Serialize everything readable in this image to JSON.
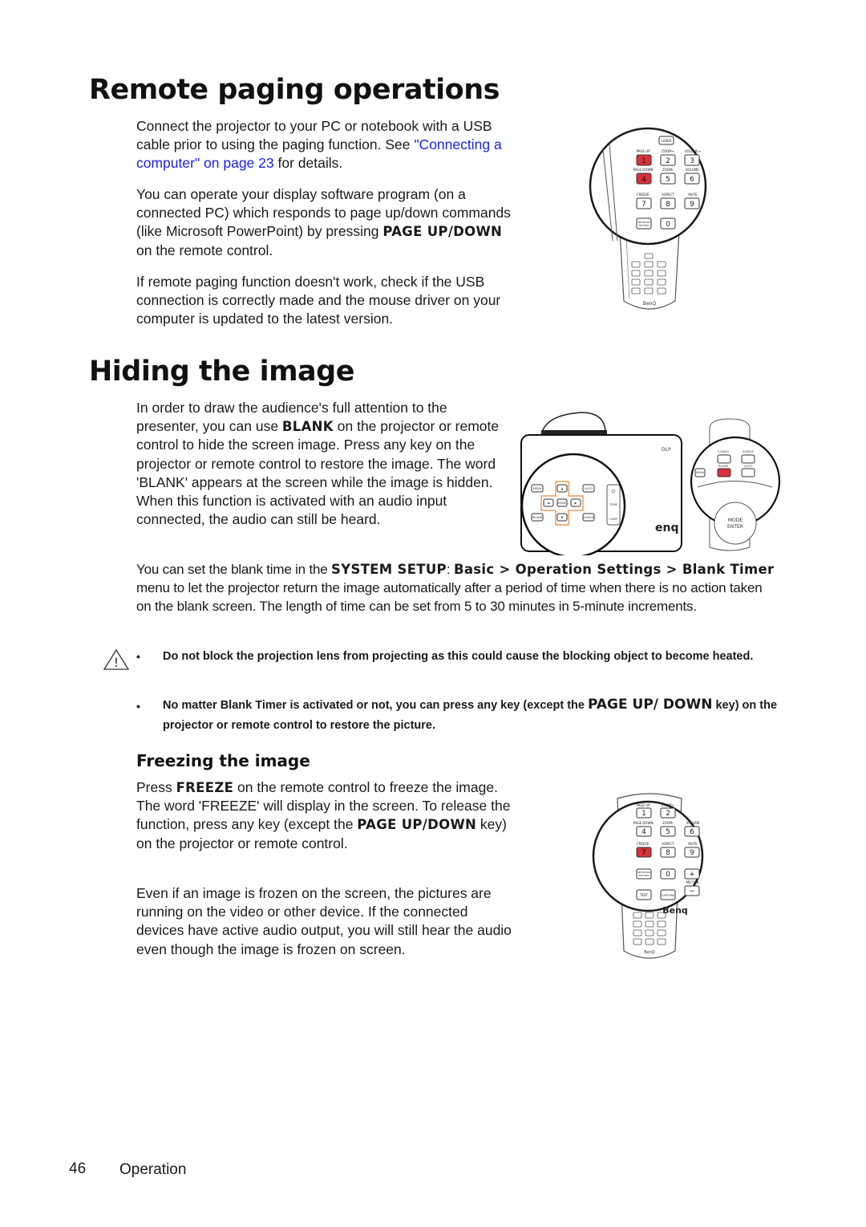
{
  "sections": {
    "remote_paging": {
      "title": "Remote paging operations",
      "p1_text_a": "Connect the projector to your PC or notebook with a USB cable prior to using the paging function. See ",
      "p1_link": "\"Connecting a computer\" on page 23",
      "p1_text_b": " for details.",
      "p2_text_a": "You can operate your display software program (on a connected PC) which responds to page up/down commands (like Microsoft PowerPoint) by pressing ",
      "p2_bold": "PAGE UP/DOWN",
      "p2_text_b": " on the remote control.",
      "p3": "If remote paging function doesn't work, check if the USB connection is correctly made and the mouse driver on your computer is updated to the latest version."
    },
    "hiding": {
      "title": "Hiding the image",
      "p1_text_a": "In order to draw the audience's full attention to the presenter, you can use ",
      "p1_bold": "BLANK",
      "p1_text_b": " on the projector or remote control to hide the screen image. Press any key on the projector or remote control to restore the image. The word 'BLANK' appears at the screen while the image is hidden. When this function is activated with an audio input connected, the audio can still be heard.",
      "p2_text_a": "You can set the blank time in the ",
      "p2_bold_a": "SYSTEM SETUP",
      "p2_colon": ": ",
      "p2_bold_b": "Basic > Operation Settings > Blank Timer",
      "p2_text_b": " menu to let the projector return the image automatically after a period of time when there is no action taken on the blank screen. The length of time can be set from 5 to 30 minutes in 5-minute increments.",
      "notes": [
        {
          "text": "Do not block the projection lens from projecting as this could cause the blocking object to become heated."
        },
        {
          "text_a": "No matter Blank Timer is activated or not, you can press any key (except the ",
          "bold": "PAGE UP/ DOWN",
          "text_b": " key) on the projector or remote control to restore the picture."
        }
      ]
    },
    "freezing": {
      "title": "Freezing the image",
      "p1_text_a": "Press ",
      "p1_bold_a": "FREEZE",
      "p1_text_b": " on the remote control to freeze the image. The word 'FREEZE' will display in the screen. To release the function, press any key (except the ",
      "p1_bold_b": "PAGE UP/DOWN",
      "p1_text_c": " key) on the projector or remote control.",
      "p2": "Even if an image is frozen on the screen, the pictures are running on the video or other device. If the connected devices have active audio output, you will still hear the audio even though the image is frozen on screen."
    }
  },
  "figures": {
    "remote1": {
      "keys": [
        "LASER",
        "PAGE UP",
        "ZOOM+",
        "VOLUME+",
        "PAGE DOWN",
        "ZOOM-",
        "VOLUME-",
        "FREEZE",
        "ASPECT",
        "MUTE",
        "NETWORK SETTING"
      ],
      "digits": [
        "1",
        "2",
        "3",
        "4",
        "5",
        "6",
        "7",
        "8",
        "9",
        "0"
      ],
      "highlighted": [
        "1",
        "4"
      ],
      "brand": "BenQ"
    },
    "projector": {
      "keys": [
        "MENU EXIT",
        "AUTO",
        "MODE ENTER",
        "BLANK",
        "SOURCE",
        "TEMP",
        "LAMP"
      ],
      "remote_keys": [
        "S-VIDEO",
        "SOURCE",
        "MENU EXIT",
        "BLANK",
        "AUTO",
        "MODE ENTER"
      ],
      "highlighted": "BLANK",
      "brand": "BenQ"
    },
    "remote2": {
      "keys": [
        "PAGE UP",
        "ZOOM+",
        "PAGE DOWN",
        "ZOOM-",
        "VOLUME",
        "FREEZE",
        "ASPECT",
        "MUTE",
        "NETWORK SETTING",
        "MIC/VOL",
        "TEST",
        "CAPTURE"
      ],
      "digits": [
        "1",
        "2",
        "4",
        "5",
        "6",
        "7",
        "8",
        "9",
        "0",
        "+",
        "−"
      ],
      "highlighted": [
        "7"
      ],
      "brand": "BenQ"
    }
  },
  "colors": {
    "highlight_red": "#d9323a",
    "link_blue": "#1a22e6",
    "dpad_orange": "#e8873a"
  },
  "footer": {
    "page_number": "46",
    "section": "Operation"
  }
}
